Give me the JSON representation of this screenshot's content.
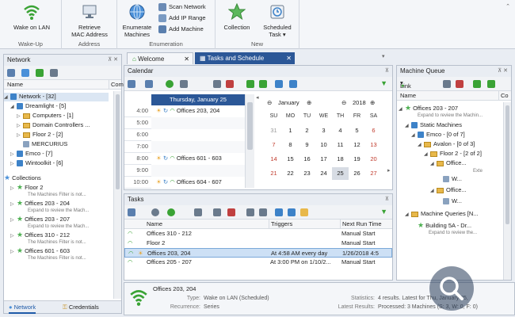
{
  "ribbon": {
    "groups": [
      {
        "label": "Wake-Up",
        "buttons": [
          "Wake on LAN"
        ]
      },
      {
        "label": "Address",
        "buttons": [
          "Retrieve MAC Address"
        ]
      },
      {
        "label": "Enumeration",
        "buttons": [
          "Enumerate Machines"
        ],
        "small": [
          "Scan Network",
          "Add IP Range",
          "Add Machine"
        ]
      },
      {
        "label": "New",
        "buttons": [
          "Collection",
          "Scheduled Task"
        ]
      }
    ],
    "wake_on_lan": "Wake on LAN",
    "retrieve_1": "Retrieve",
    "retrieve_2": "MAC Address",
    "enumerate_1": "Enumerate",
    "enumerate_2": "Machines",
    "scan_network": "Scan Network",
    "add_ip_range": "Add IP Range",
    "add_machine": "Add Machine",
    "collection": "Collection",
    "scheduled_1": "Scheduled",
    "scheduled_2": "Task",
    "g_wakeup": "Wake-Up",
    "g_address": "Address",
    "g_enum": "Enumeration",
    "g_new": "New"
  },
  "network_panel": {
    "title": "Network",
    "col_name": "Name",
    "col_com": "Com",
    "items": [
      "Network - [32]",
      "Dreamlight - [5]",
      "Computers - [1]",
      "Domain Controllers ...",
      "Floor 2 - [2]",
      "MERCURIUS",
      "Emco - [7]",
      "Wintoolkit - [6]"
    ],
    "collections_label": "Collections",
    "collections": [
      {
        "name": "Floor 2",
        "sub": "The Machines Filter is not..."
      },
      {
        "name": "Offices 203 - 204",
        "sub": "Expand to review the Mach..."
      },
      {
        "name": "Offices 203 - 207",
        "sub": "Expand to review the Mach..."
      },
      {
        "name": "Offices 310 - 212",
        "sub": "The Machines Filter is not..."
      },
      {
        "name": "Offices 601 - 603",
        "sub": "The Machines Filter is not..."
      }
    ],
    "bottom_tab_network": "Network",
    "bottom_tab_credentials": "Credentials"
  },
  "tabs": {
    "welcome": "Welcome",
    "tasks": "Tasks and Schedule"
  },
  "calendar": {
    "title": "Calendar",
    "day_header": "Thursday, January 25",
    "times": [
      "4:00",
      "5:00",
      "6:00",
      "7:00",
      "8:00",
      "9:00",
      "10:00"
    ],
    "events": [
      "Offices 203, 204",
      "Offices 601 - 603",
      "Offices 604 - 607"
    ],
    "month": "January",
    "year": "2018",
    "weekdays": [
      "SU",
      "MO",
      "TU",
      "WE",
      "TH",
      "FR",
      "SA"
    ],
    "weeks": [
      [
        "31",
        "1",
        "2",
        "3",
        "4",
        "5",
        "6"
      ],
      [
        "7",
        "8",
        "9",
        "10",
        "11",
        "12",
        "13"
      ],
      [
        "14",
        "15",
        "16",
        "17",
        "18",
        "19",
        "20"
      ],
      [
        "21",
        "22",
        "23",
        "24",
        "25",
        "26",
        "27"
      ]
    ]
  },
  "tasks": {
    "title": "Tasks",
    "columns": [
      "Name",
      "Triggers",
      "Next Run Time"
    ],
    "rows": [
      {
        "name": "Offices 310 - 212",
        "triggers": "",
        "next": "Manual Start"
      },
      {
        "name": "Floor 2",
        "triggers": "",
        "next": "Manual Start"
      },
      {
        "name": "Offices 203, 204",
        "triggers": "At 4:58 AM every day",
        "next": "1/26/2018 4:5"
      },
      {
        "name": "Offices 205 - 207",
        "triggers": "At 3:00 PM on 1/10/2...",
        "next": "Manual Start"
      }
    ]
  },
  "details": {
    "name": "Offices 203, 204",
    "type_label": "Type:",
    "type_value": "Wake on LAN (Scheduled)",
    "recurrence_label": "Recurrence:",
    "recurrence_value": "Series",
    "statistics_label": "Statistics:",
    "statistics_value": "4 results. Latest for Thu, January 25,",
    "latest_label": "Latest Results:",
    "latest_value": "Processed: 3 Machines (S: 3, W: 0, F: 0)"
  },
  "queue": {
    "title": "Machine Queue",
    "link": "Link",
    "col_name": "Name",
    "col_co": "Co",
    "items": [
      {
        "text": "Offices 203 - 207",
        "sub": "Expand to review the Machin..."
      },
      {
        "text": "Static Machines"
      },
      {
        "text": "Emco - [0 of 7]"
      },
      {
        "text": "Avalon - [0 of 3]"
      },
      {
        "text": "Floor 2 - [2 of 2]"
      },
      {
        "text": "Office...",
        "sub": "Exte"
      },
      {
        "text": "W..."
      },
      {
        "text": "Office..."
      },
      {
        "text": "W..."
      },
      {
        "text": "Machine Queries [N..."
      },
      {
        "text": "Building 5A - Dr...",
        "sub": "Expand to review the..."
      }
    ]
  },
  "colors": {
    "accent": "#1e5aa8",
    "green": "#3aa335",
    "folder": "#e8b84a"
  }
}
